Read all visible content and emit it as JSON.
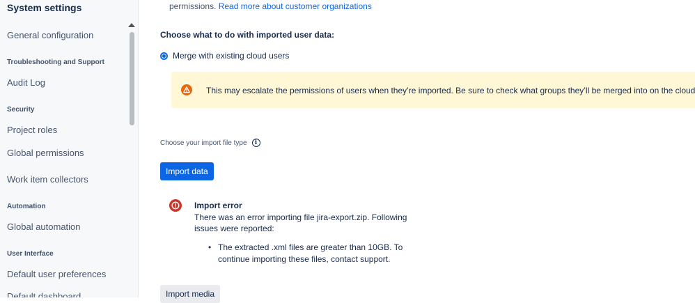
{
  "sidebar": {
    "title": "System settings",
    "items": [
      {
        "type": "item",
        "label": "General configuration"
      },
      {
        "type": "heading",
        "label": "Troubleshooting and Support"
      },
      {
        "type": "item",
        "label": "Audit Log"
      },
      {
        "type": "heading",
        "label": "Security"
      },
      {
        "type": "item",
        "label": "Project roles"
      },
      {
        "type": "item",
        "label": "Global permissions"
      },
      {
        "type": "item",
        "label": "Work item collectors"
      },
      {
        "type": "heading",
        "label": "Automation"
      },
      {
        "type": "item",
        "label": "Global automation"
      },
      {
        "type": "heading",
        "label": "User Interface"
      },
      {
        "type": "item",
        "label": "Default user preferences"
      },
      {
        "type": "item",
        "label": "Default dashboard"
      }
    ]
  },
  "main": {
    "intro_text": "permissions.",
    "intro_link": "Read more about customer organizations",
    "choose_heading": "Choose what to do with imported user data:",
    "radio_label": "Merge with existing cloud users",
    "warning_text": "This may escalate the permissions of users when they’re imported. Be sure to check what groups they’ll be merged into on the cloud site.",
    "file_type_label": "Choose your import file type",
    "import_data_button": "Import data",
    "error": {
      "title": "Import error",
      "body": "There was an error importing file jira-export.zip. Following issues were reported:",
      "issue": "The extracted .xml files are greater than 10GB. To continue importing these files, contact support."
    },
    "import_media_button": "Import media"
  },
  "colors": {
    "primary": "#0c66e4",
    "warning_bg": "#fff7d6",
    "warning_icon": "#e56910",
    "error_icon": "#c9372c"
  }
}
